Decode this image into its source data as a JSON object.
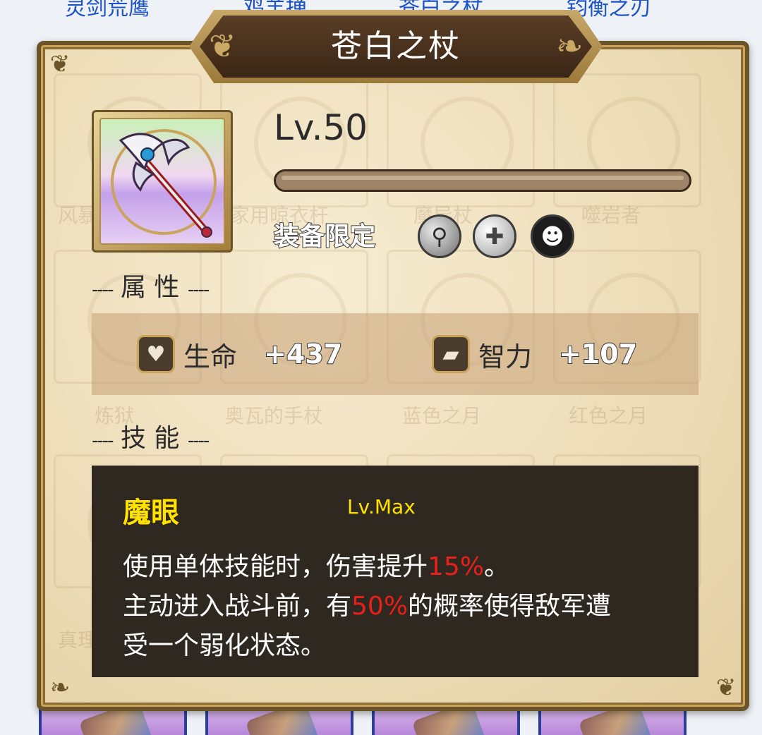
{
  "background": {
    "tabs": [
      "灵剑荒鹰",
      "鸡羊掸",
      "苍白之杖",
      "钧衡之刃"
    ],
    "ghost_labels": [
      "风暴",
      "家用晾衣杆",
      "魔导杖",
      "噬岩者",
      "炼狱",
      "奥瓦的手杖",
      "蓝色之月",
      "红色之月",
      "真理"
    ]
  },
  "item": {
    "title": "苍白之杖",
    "level": "Lv.50",
    "level_progress": 0,
    "equip_limit_label": "装备限定",
    "class_icons": [
      "staff-class-icon",
      "cleric-class-icon",
      "demon-class-icon"
    ]
  },
  "attributes": {
    "section_title": "属 性",
    "stats": [
      {
        "icon": "heart-icon",
        "name": "生命",
        "value": "+437"
      },
      {
        "icon": "book-icon",
        "name": "智力",
        "value": "+107"
      }
    ]
  },
  "skills": {
    "section_title": "技 能",
    "name": "魔眼",
    "level": "Lv.Max",
    "desc_line1_a": "使用单体技能时，伤害提升",
    "desc_line1_hl": "15%",
    "desc_line1_b": "。",
    "desc_line2_a": "主动进入战斗前，有",
    "desc_line2_hl": "50%",
    "desc_line2_b": "的概率使得敌军遭",
    "desc_line3": "受一个弱化状态。"
  },
  "colors": {
    "highlight": "#e8201c",
    "skill_name": "#ffe200",
    "tab_link": "#1b52c9",
    "panel_bg": "#ecdcb6",
    "skill_box_bg": "#2f2821"
  }
}
